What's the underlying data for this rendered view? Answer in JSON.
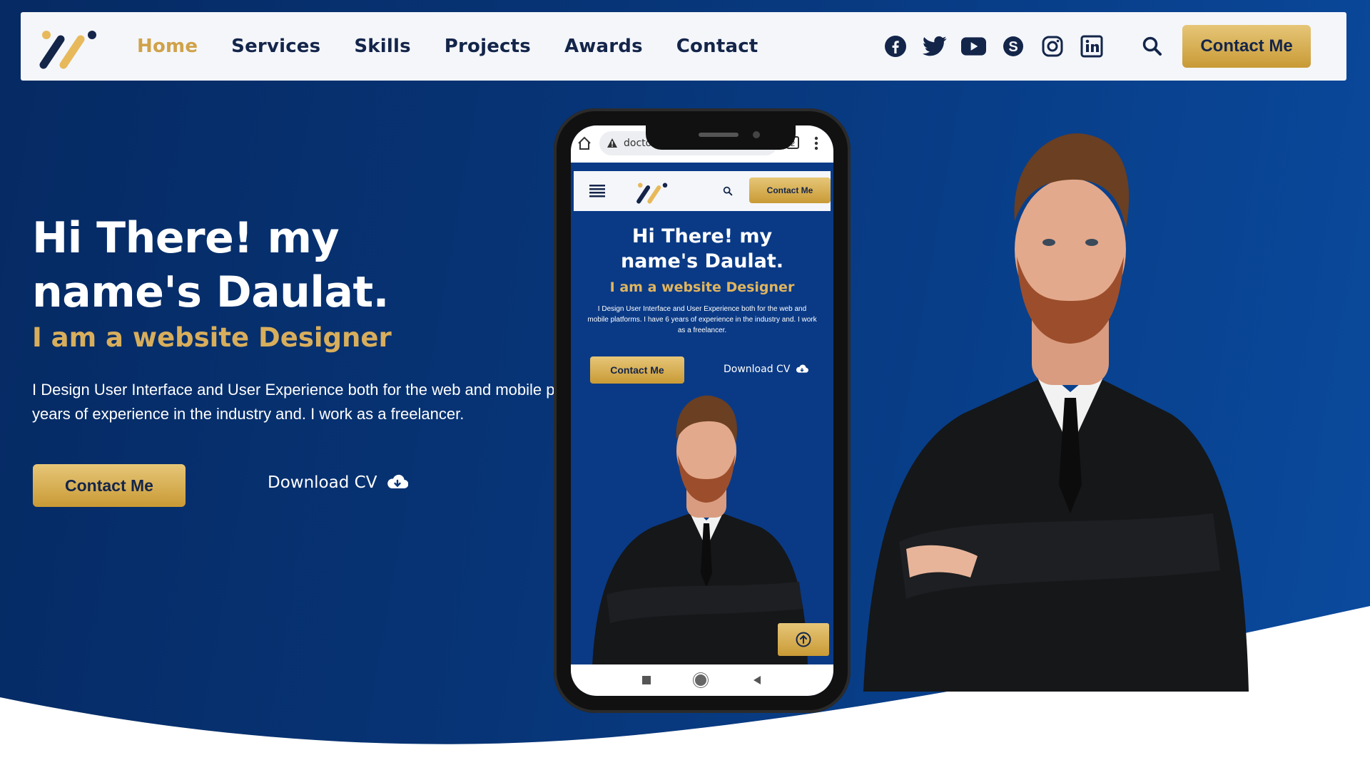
{
  "nav": {
    "links": [
      "Home",
      "Services",
      "Skills",
      "Projects",
      "Awards",
      "Contact"
    ],
    "active": "Home",
    "socials": [
      "facebook-icon",
      "twitter-icon",
      "youtube-icon",
      "skype-icon",
      "instagram-icon",
      "linkedin-icon"
    ],
    "cta": "Contact Me"
  },
  "hero": {
    "title_line1": "Hi There! my",
    "title_line2": "name's Daulat.",
    "subtitle": "I am a website Designer",
    "desc_line1": "I Design User Interface and User Experience both for the web and mobile p",
    "desc_line2": "years of experience in the industry and. I work as a freelancer.",
    "cta": "Contact Me",
    "download": "Download CV"
  },
  "phone": {
    "url": "doctordaulat.anaxi.com/...",
    "tab_count": "2",
    "cta": "Contact Me",
    "title_line1": "Hi There! my",
    "title_line2": "name's Daulat.",
    "subtitle": "I am a website Designer",
    "desc": "I Design User Interface and User Experience both for the web and mobile platforms. I have 6 years of experience in the industry and. I work as a freelancer.",
    "button": "Contact Me",
    "download": "Download CV"
  },
  "colors": {
    "navy": "#073476",
    "gold": "#d0a24a",
    "text_dark": "#14254a"
  }
}
